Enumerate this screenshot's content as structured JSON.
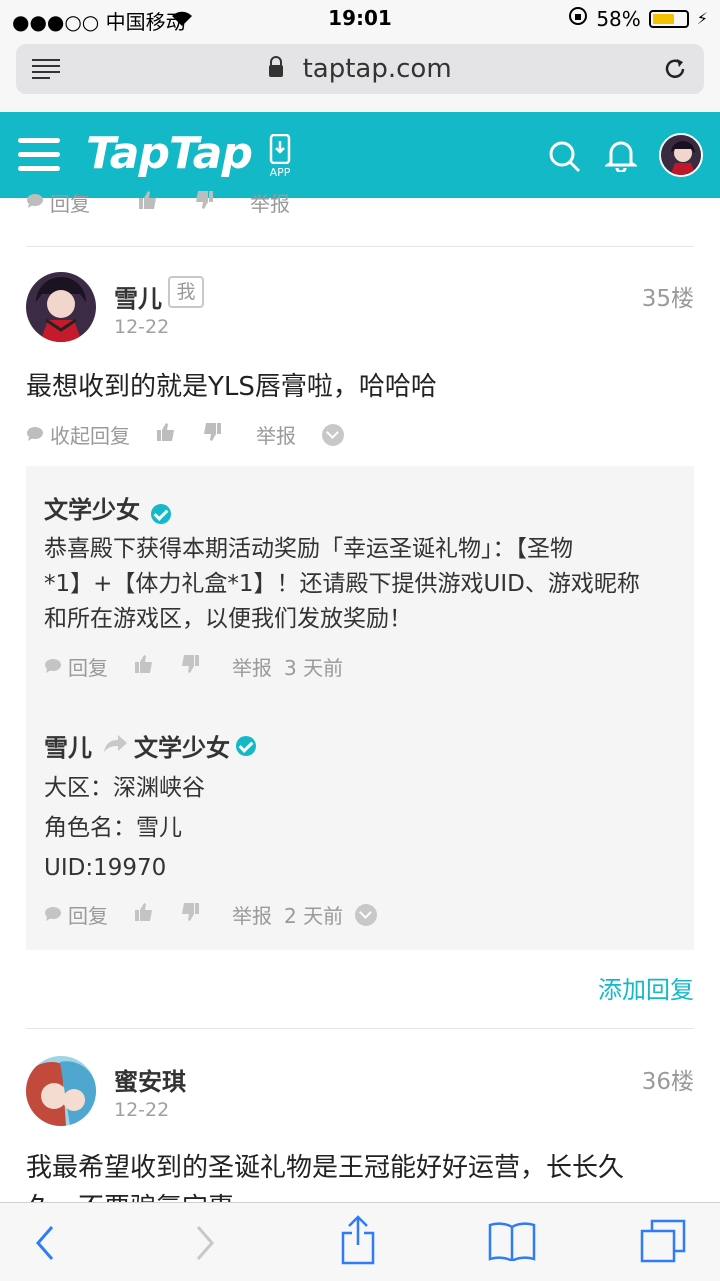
{
  "status_bar": {
    "carrier": "●●●○○ 中国移动",
    "time": "19:01",
    "battery_text": "58%",
    "battery_level": 0.58
  },
  "browser": {
    "url": "taptap.com"
  },
  "header": {
    "logo": "TapTap",
    "app_label": "APP"
  },
  "prev_actions": {
    "reply": "回复",
    "report": "举报"
  },
  "post35": {
    "author": "雪儿",
    "me_tag": "我",
    "date": "12-22",
    "floor": "35楼",
    "content": "最想收到的就是YLS唇膏啦，哈哈哈",
    "collapse_reply": "收起回复",
    "report": "举报",
    "replies": [
      {
        "author": "文学少女",
        "lines": [
          "恭喜殿下获得本期活动奖励「幸运圣诞礼物」：【圣物",
          "*1】+【体力礼盒*1】！还请殿下提供游戏UID、游戏昵称",
          "和所在游戏区，以便我们发放奖励！"
        ],
        "reply": "回复",
        "report": "举报",
        "time": "3 天前"
      },
      {
        "author": "雪儿",
        "to": "文学少女",
        "lines": [
          "大区：深渊峡谷",
          "角色名：雪儿",
          "UID:19970"
        ],
        "reply": "回复",
        "report": "举报",
        "time": "2 天前"
      }
    ],
    "add_reply": "添加回复"
  },
  "post36": {
    "author": "蜜安琪",
    "date": "12-22",
    "floor": "36楼",
    "content_line1": "我最希望收到的圣诞礼物是王冠能好好运营，长长久",
    "content_line2": "久，不要骗氪宝惠"
  },
  "colors": {
    "brand": "#14b9c8",
    "ios_blue": "#2f7cf6"
  }
}
